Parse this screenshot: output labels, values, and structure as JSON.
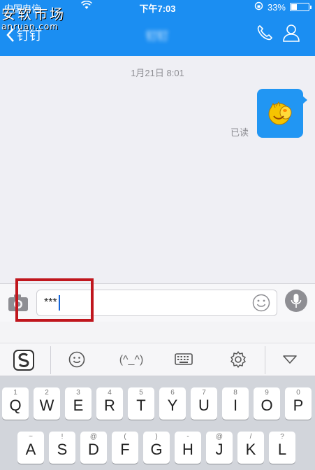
{
  "status_bar": {
    "carrier": "中国电信",
    "time": "下午7:03",
    "battery_percent": 33,
    "battery_label": "33%"
  },
  "watermark": {
    "line1": "安软市场",
    "line2": "anruan.com"
  },
  "nav": {
    "back_label": "钉钉",
    "title": "钉钉"
  },
  "chat": {
    "timestamp": "1月21日 8:01",
    "read_status": "已读",
    "message_icon": "emoji-sticker-icon"
  },
  "input": {
    "value": "***"
  },
  "keyboard_toolbar": {
    "emoticon_label": "(^_^)"
  },
  "keyboard": {
    "row1": [
      {
        "key": "Q",
        "sub": "1"
      },
      {
        "key": "W",
        "sub": "2"
      },
      {
        "key": "E",
        "sub": "3"
      },
      {
        "key": "R",
        "sub": "4"
      },
      {
        "key": "T",
        "sub": "5"
      },
      {
        "key": "Y",
        "sub": "6"
      },
      {
        "key": "U",
        "sub": "7"
      },
      {
        "key": "I",
        "sub": "8"
      },
      {
        "key": "O",
        "sub": "9"
      },
      {
        "key": "P",
        "sub": "0"
      }
    ],
    "row2": [
      {
        "key": "A",
        "sub": "~"
      },
      {
        "key": "S",
        "sub": "!"
      },
      {
        "key": "D",
        "sub": "@"
      },
      {
        "key": "F",
        "sub": "("
      },
      {
        "key": "G",
        "sub": ")"
      },
      {
        "key": "H",
        "sub": "-"
      },
      {
        "key": "J",
        "sub": "@"
      },
      {
        "key": "K",
        "sub": "/"
      },
      {
        "key": "L",
        "sub": "?"
      }
    ]
  },
  "colors": {
    "accent": "#1b8ef2",
    "bubble": "#2196f3",
    "highlight": "#c0161d"
  }
}
